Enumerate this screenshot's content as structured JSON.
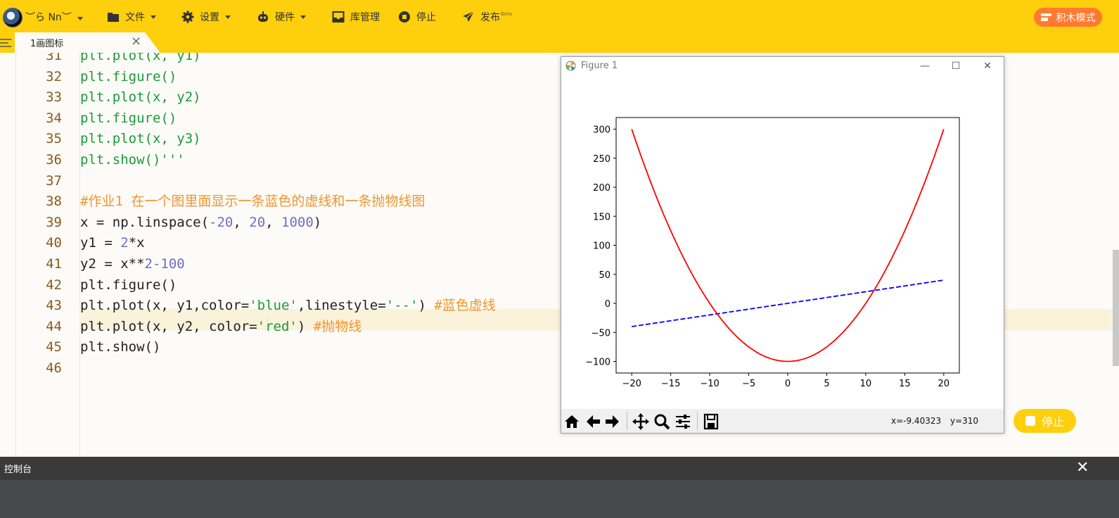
{
  "topbar": {
    "user_name": "︶ら Nn︶",
    "menus": [
      {
        "label": "文件",
        "icon": "folder-icon",
        "dropdown": true
      },
      {
        "label": "设置",
        "icon": "gear-icon",
        "dropdown": true
      },
      {
        "label": "硬件",
        "icon": "robot-icon",
        "dropdown": true
      },
      {
        "label": "库管理",
        "icon": "library-icon",
        "dropdown": false
      },
      {
        "label": "停止",
        "icon": "stop-circle-icon",
        "dropdown": false
      },
      {
        "label": "发布",
        "icon": "send-icon",
        "dropdown": false
      }
    ],
    "publish_badge": "Beta",
    "mode_button": "积木模式"
  },
  "tab": {
    "label": "1画图标"
  },
  "editor": {
    "lines": [
      {
        "num": "31",
        "html": "<span class='g'>plt.plot(x, y1)</span>"
      },
      {
        "num": "32",
        "html": "<span class='g'>plt.figure()</span>"
      },
      {
        "num": "33",
        "html": "<span class='g'>plt.plot(x, y2)</span>"
      },
      {
        "num": "34",
        "html": "<span class='g'>plt.figure()</span>"
      },
      {
        "num": "35",
        "html": "<span class='g'>plt.plot(x, y3)</span>"
      },
      {
        "num": "36",
        "html": "<span class='g'>plt.show()'''</span>"
      },
      {
        "num": "37",
        "html": ""
      },
      {
        "num": "38",
        "html": "<span class='c'>#作业1 在一个图里面显示一条蓝色的虚线和一条抛物线图</span>"
      },
      {
        "num": "39",
        "html": "<span class='k'>x = np.linspace(</span><span class='n'>-20</span><span class='k'>, </span><span class='n'>20</span><span class='k'>, </span><span class='n'>1000</span><span class='k'>)</span>"
      },
      {
        "num": "40",
        "html": "<span class='k'>y1 = </span><span class='n'>2</span><span class='k'>*x</span>"
      },
      {
        "num": "41",
        "html": "<span class='k'>y2 = x**</span><span class='n'>2</span><span class='n'>-100</span>"
      },
      {
        "num": "42",
        "html": "<span class='k'>plt.figure()</span>"
      },
      {
        "num": "43",
        "html": "<span class='k'>plt.plot(x, y1,color=</span><span class='s'>'blue'</span><span class='k'>,linestyle=</span><span class='s'>'--'</span><span class='k'>) </span><span class='c'>#蓝色虚线</span>"
      },
      {
        "num": "44",
        "html": "<span class='k'>plt.plot(x, y2, color=</span><span class='s'>'red'</span><span class='k'>) </span><span class='c'>#抛物线</span>"
      },
      {
        "num": "45",
        "html": "<span class='k'>plt.show()</span>"
      },
      {
        "num": "46",
        "html": ""
      }
    ]
  },
  "figure": {
    "window_title": "Figure 1",
    "coords_x": "x=-9.40323",
    "coords_y": "y=310"
  },
  "chart_data": {
    "type": "line",
    "title": "",
    "xlabel": "",
    "ylabel": "",
    "xlim": [
      -22,
      22
    ],
    "ylim": [
      -120,
      320
    ],
    "xticks": [
      -20,
      -15,
      -10,
      -5,
      0,
      5,
      10,
      15,
      20
    ],
    "yticks": [
      -100,
      -50,
      0,
      50,
      100,
      150,
      200,
      250,
      300
    ],
    "xtick_labels": [
      "−20",
      "−15",
      "−10",
      "−5",
      "0",
      "5",
      "10",
      "15",
      "20"
    ],
    "ytick_labels": [
      "−100",
      "−50",
      "0",
      "50",
      "100",
      "150",
      "200",
      "250",
      "300"
    ],
    "grid": false,
    "series": [
      {
        "x": [
          -20,
          20
        ],
        "y": [
          -40,
          40
        ],
        "color": "#0000ff",
        "linestyle": "dashed"
      },
      {
        "x": [
          -20,
          -17.5,
          -15,
          -12.5,
          -10,
          -7.5,
          -5,
          -2.5,
          0,
          2.5,
          5,
          7.5,
          10,
          12.5,
          15,
          17.5,
          20
        ],
        "y": [
          300,
          206.25,
          125,
          56.25,
          0,
          -43.75,
          -75,
          -93.75,
          -100,
          -93.75,
          -75,
          -43.75,
          0,
          56.25,
          125,
          206.25,
          300
        ],
        "color": "#ff0000",
        "linestyle": "solid"
      }
    ]
  },
  "stop_button": {
    "label": "停止"
  },
  "console": {
    "title": "控制台"
  }
}
